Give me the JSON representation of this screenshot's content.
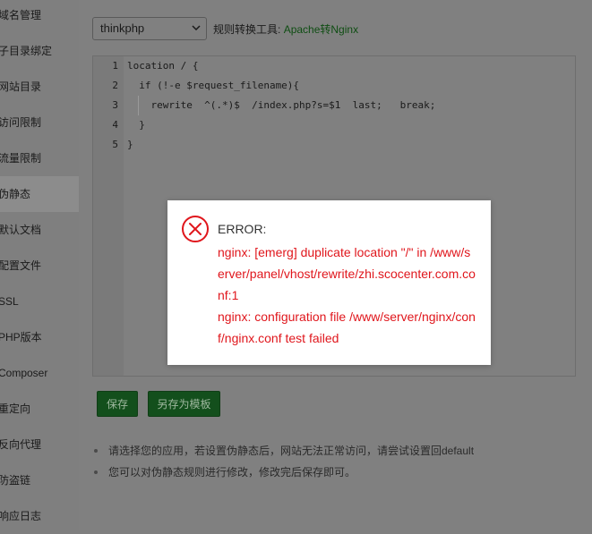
{
  "sidebar": {
    "items": [
      {
        "label": "域名管理"
      },
      {
        "label": "子目录绑定"
      },
      {
        "label": "网站目录"
      },
      {
        "label": "访问限制"
      },
      {
        "label": "流量限制"
      },
      {
        "label": "伪静态",
        "active": true
      },
      {
        "label": "默认文档"
      },
      {
        "label": "配置文件"
      },
      {
        "label": "SSL"
      },
      {
        "label": "PHP版本"
      },
      {
        "label": "Composer"
      },
      {
        "label": "重定向"
      },
      {
        "label": "反向代理"
      },
      {
        "label": "防盗链"
      },
      {
        "label": "响应日志"
      }
    ]
  },
  "toolbar": {
    "select_value": "thinkphp",
    "tool_label": "规则转换工具:",
    "tool_link": "Apache转Nginx"
  },
  "editor": {
    "lines": [
      {
        "no": "1",
        "text": "location / {"
      },
      {
        "no": "2",
        "text": "  if (!-e $request_filename){"
      },
      {
        "no": "3",
        "text": "    rewrite  ^(.*)$  /index.php?s=$1  last;   break;"
      },
      {
        "no": "4",
        "text": "  }"
      },
      {
        "no": "5",
        "text": "}"
      }
    ]
  },
  "buttons": {
    "save": "保存",
    "save_as_template": "另存为模板"
  },
  "notes": [
    "请选择您的应用，若设置伪静态后，网站无法正常访问，请尝试设置回default",
    "您可以对伪静态规则进行修改，修改完后保存即可。"
  ],
  "dialog": {
    "title": "ERROR:",
    "body_line1": "nginx: [emerg] duplicate location \"/\" in /www/server/panel/vhost/rewrite/zhi.scocenter.com.conf:1",
    "body_line2": "nginx: configuration file /www/server/nginx/conf/nginx.conf test failed"
  },
  "colors": {
    "error_red": "#e0161c",
    "button_green": "#134f1c",
    "overlay": "#7f7f7f"
  }
}
